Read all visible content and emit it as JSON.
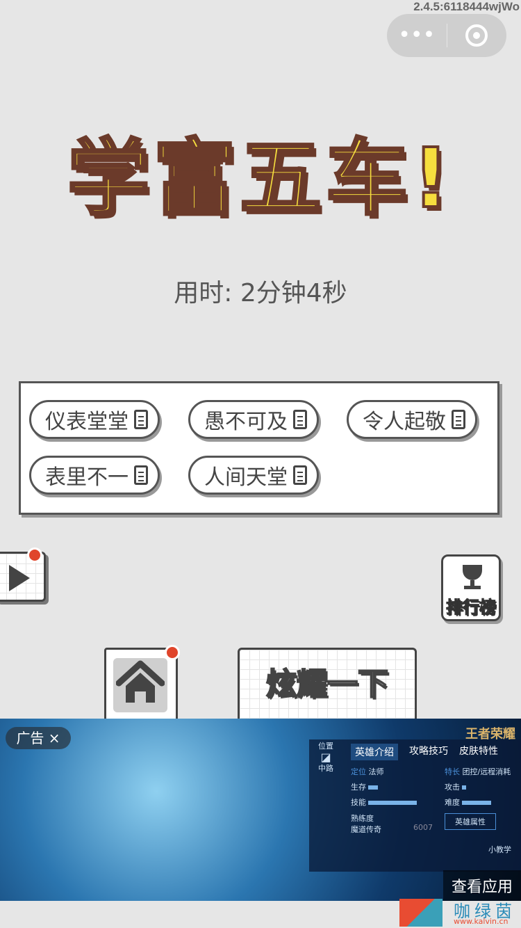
{
  "status": {
    "version": "2.4.5:6118444wjWo"
  },
  "capsule": {
    "more_icon": "more-dots-icon",
    "close_icon": "target-circle-icon"
  },
  "result": {
    "title": "学富五车!",
    "time_label": "用时: 2分钟4秒"
  },
  "idioms": [
    {
      "label": "仪表堂堂"
    },
    {
      "label": "愚不可及"
    },
    {
      "label": "令人起敬"
    },
    {
      "label": "表里不一"
    },
    {
      "label": "人间天堂"
    }
  ],
  "buttons": {
    "rank_label": "排行榜",
    "show_label": "炫耀一下"
  },
  "ad": {
    "tag": "广告 ×",
    "logo": "王者荣耀",
    "tabs": [
      "英雄介绍",
      "攻略技巧",
      "皮肤特性"
    ],
    "position_label": "位置",
    "position_value": "中路",
    "role_label": "定位",
    "role_value": "法师",
    "special_label": "特长",
    "special_value": "团控/远程消耗",
    "survive_label": "生存",
    "attack_label": "攻击",
    "skill_label": "技能",
    "difficulty_label": "难度",
    "mastery_label": "熟练度",
    "mastery_value": "魔道传奇",
    "mastery_score": "6007",
    "attr_button": "英雄属性",
    "tutorial": "小教学",
    "cta": "查看应用"
  },
  "watermark": {
    "text": "咖绿茵",
    "url": "www.kalvin.cn"
  }
}
